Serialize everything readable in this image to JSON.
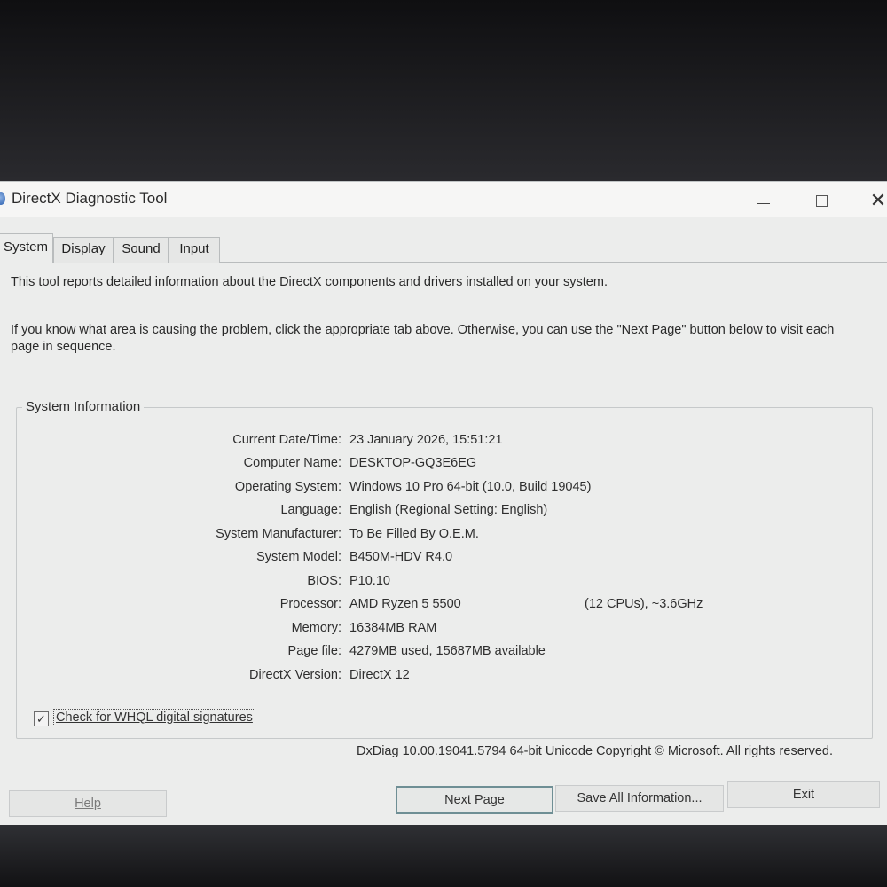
{
  "window": {
    "title": "DirectX Diagnostic Tool"
  },
  "tabs": [
    {
      "label": "System",
      "active": true
    },
    {
      "label": "Display",
      "active": false
    },
    {
      "label": "Sound",
      "active": false
    },
    {
      "label": "Input",
      "active": false
    }
  ],
  "intro": {
    "line1": "This tool reports detailed information about the DirectX components and drivers installed on your system.",
    "line2": "If you know what area is causing the problem, click the appropriate tab above.  Otherwise, you can use the \"Next Page\" button below to visit each page in sequence."
  },
  "system_info": {
    "title": "System Information",
    "rows": [
      {
        "label": "Current Date/Time:",
        "value": "23 January 2026, 15:51:21"
      },
      {
        "label": "Computer Name:",
        "value": "DESKTOP-GQ3E6EG"
      },
      {
        "label": "Operating System:",
        "value": "Windows 10 Pro 64-bit (10.0, Build 19045)"
      },
      {
        "label": "Language:",
        "value": "English (Regional Setting: English)"
      },
      {
        "label": "System Manufacturer:",
        "value": "To Be Filled By O.E.M."
      },
      {
        "label": "System Model:",
        "value": "B450M-HDV R4.0"
      },
      {
        "label": "BIOS:",
        "value": "P10.10"
      },
      {
        "label": "Processor:",
        "value": "AMD Ryzen 5 5500",
        "value2": "(12 CPUs), ~3.6GHz"
      },
      {
        "label": "Memory:",
        "value": "16384MB RAM"
      },
      {
        "label": "Page file:",
        "value": "4279MB used, 15687MB available"
      },
      {
        "label": "DirectX Version:",
        "value": "DirectX 12"
      }
    ]
  },
  "whql": {
    "label": "Check for WHQL digital signatures",
    "checked": true,
    "check_glyph": "✓"
  },
  "version_text": "DxDiag 10.00.19041.5794 64-bit Unicode  Copyright © Microsoft. All rights reserved.",
  "buttons": {
    "help": "Help",
    "next_page": "Next Page",
    "save_all": "Save All Information...",
    "exit": "Exit"
  },
  "window_controls": {
    "close_glyph": "✕"
  }
}
